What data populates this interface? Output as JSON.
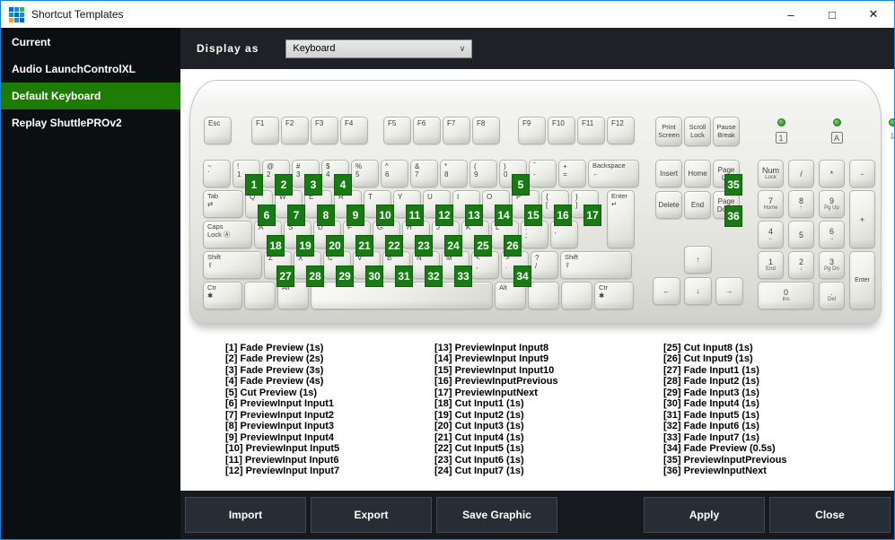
{
  "window": {
    "title": "Shortcut Templates",
    "controls": {
      "minimize": "–",
      "maximize": "□",
      "close": "✕"
    },
    "icon_grid": [
      [
        "#1565a8",
        "#1e88d2",
        "#43b049"
      ],
      [
        "#1e88d2",
        "#1565a8",
        "#1e88d2"
      ],
      [
        "#f0a02c",
        "#1e88d2",
        "#1565a8"
      ]
    ]
  },
  "colors": {
    "accent_border": "#1883d7",
    "selection_green": "#1e7b03",
    "badge_green": "#187a12",
    "sidebar_bg": "#0c0f12",
    "strip_bg": "#1e2226",
    "footer_bg": "#16191d",
    "button_bg": "#262d34"
  },
  "sidebar": {
    "items": [
      {
        "label": "Current",
        "selected": false
      },
      {
        "label": "Audio LaunchControlXL",
        "selected": false
      },
      {
        "label": "Default Keyboard",
        "selected": true
      },
      {
        "label": "Replay ShuttlePROv2",
        "selected": false
      }
    ]
  },
  "toolbar": {
    "display_as_label": "Display as",
    "display_as_value": "Keyboard"
  },
  "keyboard": {
    "esc": "Esc",
    "f_groups": [
      [
        "F1",
        "F2",
        "F3",
        "F4"
      ],
      [
        "F5",
        "F6",
        "F7",
        "F8"
      ],
      [
        "F9",
        "F10",
        "F11",
        "F12"
      ]
    ],
    "system_keys": [
      [
        "Print",
        "Screen"
      ],
      [
        "Scroll",
        "Lock"
      ],
      [
        "Pause",
        "Break"
      ]
    ],
    "leds": [
      {
        "label": "1",
        "boxed": true
      },
      {
        "label": "A",
        "boxed": true
      },
      {
        "label": "⇩",
        "boxed": false
      }
    ],
    "main_rows": [
      [
        {
          "l": [
            "~",
            "`"
          ]
        },
        {
          "l": [
            "!",
            "1"
          ],
          "badge": "1"
        },
        {
          "l": [
            "@",
            "2"
          ],
          "badge": "2"
        },
        {
          "l": [
            "#",
            "3"
          ],
          "badge": "3"
        },
        {
          "l": [
            "$",
            "4"
          ],
          "badge": "4"
        },
        {
          "l": [
            "%",
            "5"
          ]
        },
        {
          "l": [
            "^",
            "6"
          ]
        },
        {
          "l": [
            "&",
            "7"
          ]
        },
        {
          "l": [
            "*",
            "8"
          ]
        },
        {
          "l": [
            "(",
            "9"
          ]
        },
        {
          "l": [
            ")",
            "0"
          ],
          "badge": "5"
        },
        {
          "l": [
            "‾",
            "-"
          ]
        },
        {
          "l": [
            "+",
            "="
          ]
        },
        {
          "l": [
            "Backspace",
            "←"
          ],
          "w": 1.8,
          "small": true,
          "name": "backspace"
        }
      ],
      [
        {
          "l": [
            "Tab",
            "⇄"
          ],
          "w": 1.45,
          "small": true,
          "name": "tab"
        },
        {
          "l": [
            "Q"
          ],
          "badge": "6"
        },
        {
          "l": [
            "W"
          ],
          "badge": "7"
        },
        {
          "l": [
            "E"
          ],
          "badge": "8"
        },
        {
          "l": [
            "R"
          ],
          "badge": "9"
        },
        {
          "l": [
            "T"
          ],
          "badge": "10"
        },
        {
          "l": [
            "Y"
          ],
          "badge": "11"
        },
        {
          "l": [
            "U"
          ],
          "badge": "12"
        },
        {
          "l": [
            "I"
          ],
          "badge": "13"
        },
        {
          "l": [
            "O"
          ],
          "badge": "14"
        },
        {
          "l": [
            "P"
          ],
          "badge": "15"
        },
        {
          "l": [
            "{",
            "["
          ],
          "badge": "16"
        },
        {
          "l": [
            "}",
            "]"
          ],
          "badge": "17"
        }
      ],
      [
        {
          "l": [
            "Caps",
            "Lock Ⓐ"
          ],
          "w": 1.75,
          "small": true,
          "name": "caps-lock"
        },
        {
          "l": [
            "A"
          ],
          "badge": "18"
        },
        {
          "l": [
            "S"
          ],
          "badge": "19"
        },
        {
          "l": [
            "D"
          ],
          "badge": "20"
        },
        {
          "l": [
            "F"
          ],
          "badge": "21"
        },
        {
          "l": [
            "G"
          ],
          "badge": "22"
        },
        {
          "l": [
            "H"
          ],
          "badge": "23"
        },
        {
          "l": [
            "J"
          ],
          "badge": "24"
        },
        {
          "l": [
            "K"
          ],
          "badge": "25"
        },
        {
          "l": [
            "L"
          ],
          "badge": "26"
        },
        {
          "l": [
            ":",
            ";"
          ]
        },
        {
          "l": [
            "\"",
            "'"
          ]
        }
      ],
      [
        {
          "l": [
            "Shift",
            "⇧"
          ],
          "w": 2.1,
          "small": true,
          "name": "shift-left"
        },
        {
          "l": [
            "Z"
          ],
          "badge": "27"
        },
        {
          "l": [
            "X"
          ],
          "badge": "28"
        },
        {
          "l": [
            "C"
          ],
          "badge": "29"
        },
        {
          "l": [
            "V"
          ],
          "badge": "30"
        },
        {
          "l": [
            "B"
          ],
          "badge": "31"
        },
        {
          "l": [
            "N"
          ],
          "badge": "32"
        },
        {
          "l": [
            "M"
          ],
          "badge": "33"
        },
        {
          "l": [
            "<",
            ","
          ]
        },
        {
          "l": [
            ">",
            "."
          ],
          "badge": "34"
        },
        {
          "l": [
            "?",
            "/"
          ]
        },
        {
          "l": [
            "Shift",
            "⇧"
          ],
          "w": 2.5,
          "small": true,
          "name": "shift-right"
        }
      ],
      [
        {
          "l": [
            "Ctr",
            "✱"
          ],
          "w": 1.4,
          "small": true,
          "name": "ctrl-left"
        },
        {
          "l": [],
          "w": 1.15,
          "name": "blank-key"
        },
        {
          "l": [
            "Alt"
          ],
          "w": 1.15,
          "small": true,
          "name": "alt-left"
        },
        {
          "l": [],
          "w": 6.3,
          "name": "space"
        },
        {
          "l": [
            "Alt"
          ],
          "w": 1.15,
          "small": true,
          "name": "alt-right"
        },
        {
          "l": [],
          "w": 1.15,
          "name": "blank-key"
        },
        {
          "l": [],
          "w": 1.15,
          "name": "blank-key"
        },
        {
          "l": [
            "Ctr",
            "✱"
          ],
          "w": 1.4,
          "small": true,
          "name": "ctrl-right"
        }
      ]
    ],
    "enter_main": [
      "Enter",
      "↵"
    ],
    "nav_rows": [
      [
        {
          "l": [
            "Insert"
          ]
        },
        {
          "l": [
            "Home"
          ]
        },
        {
          "l": [
            "Page",
            "Up"
          ],
          "badge": "35"
        }
      ],
      [
        {
          "l": [
            "Delete"
          ]
        },
        {
          "l": [
            "End"
          ]
        },
        {
          "l": [
            "Page",
            "Down"
          ],
          "badge": "36"
        }
      ]
    ],
    "arrows": {
      "up": "↑",
      "row": [
        "←",
        "↓",
        "→"
      ]
    },
    "numpad_rows": [
      [
        {
          "l": "Num",
          "sub": "Lock"
        },
        {
          "l": "/"
        },
        {
          "l": "*"
        },
        {
          "l": "-"
        }
      ],
      [
        {
          "l": "7",
          "sub": "Home"
        },
        {
          "l": "8",
          "sub": "↑"
        },
        {
          "l": "9",
          "sub": "Pg Up"
        },
        {
          "l": "+",
          "tall": true
        }
      ],
      [
        {
          "l": "4",
          "sub": "←"
        },
        {
          "l": "5"
        },
        {
          "l": "6",
          "sub": "→"
        }
      ],
      [
        {
          "l": "1",
          "sub": "End"
        },
        {
          "l": "2",
          "sub": "↓"
        },
        {
          "l": "3",
          "sub": "Pg Dn"
        },
        {
          "l": "Enter",
          "tall": true,
          "smalltxt": true
        }
      ],
      [
        {
          "l": "0",
          "sub": "Ins",
          "wide": true
        },
        {
          "l": ".",
          "sub": "Del"
        }
      ]
    ]
  },
  "shortcut_columns": [
    [
      "[1] Fade Preview (1s)",
      "[2] Fade Preview (2s)",
      "[3] Fade Preview (3s)",
      "[4] Fade Preview (4s)",
      "[5] Cut Preview (1s)",
      "[6] PreviewInput Input1",
      "[7] PreviewInput Input2",
      "[8] PreviewInput Input3",
      "[9] PreviewInput Input4",
      "[10] PreviewInput Input5",
      "[11] PreviewInput Input6",
      "[12] PreviewInput Input7"
    ],
    [
      "[13] PreviewInput Input8",
      "[14] PreviewInput Input9",
      "[15] PreviewInput Input10",
      "[16] PreviewInputPrevious",
      "[17] PreviewInputNext",
      "[18] Cut Input1 (1s)",
      "[19] Cut Input2 (1s)",
      "[20] Cut Input3 (1s)",
      "[21] Cut Input4 (1s)",
      "[22] Cut Input5 (1s)",
      "[23] Cut Input6 (1s)",
      "[24] Cut Input7 (1s)"
    ],
    [
      "[25] Cut Input8 (1s)",
      "[26] Cut Input9 (1s)",
      "[27] Fade Input1 (1s)",
      "[28] Fade Input2 (1s)",
      "[29] Fade Input3 (1s)",
      "[30] Fade Input4 (1s)",
      "[31] Fade Input5 (1s)",
      "[32] Fade Input6 (1s)",
      "[33] Fade Input7 (1s)",
      "[34] Fade Preview (0.5s)",
      "[35] PreviewInputPrevious",
      "[36] PreviewInputNext"
    ]
  ],
  "footer": {
    "left_buttons": [
      {
        "label": "Import",
        "name": "import-button"
      },
      {
        "label": "Export",
        "name": "export-button"
      },
      {
        "label": "Save Graphic",
        "name": "save-graphic-button"
      }
    ],
    "right_buttons": [
      {
        "label": "Apply",
        "name": "apply-button"
      },
      {
        "label": "Close",
        "name": "close-button"
      }
    ]
  }
}
